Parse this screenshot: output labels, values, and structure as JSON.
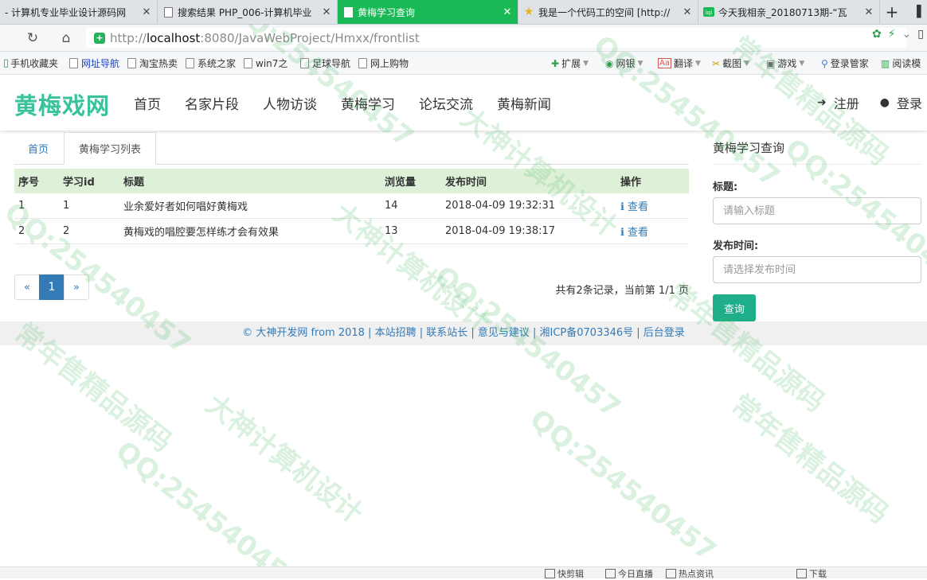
{
  "browser": {
    "tabs": [
      {
        "label": "- 计算机专业毕业设计源码网",
        "active": false,
        "icon": "page-icon"
      },
      {
        "label": "搜索结果 PHP_006-计算机毕业",
        "active": false,
        "icon": "page-icon"
      },
      {
        "label": "黄梅学习查询",
        "active": true,
        "icon": "page-icon"
      },
      {
        "label": "我是一个代码工的空间 [http://",
        "active": false,
        "icon": "star-icon"
      },
      {
        "label": "今天我相亲_20180713期-“瓦",
        "active": false,
        "icon": "video-icon"
      }
    ],
    "new_tab": "+",
    "address": {
      "scheme": "http://",
      "host": "localhost",
      "rest": ":8080/JavaWebProject/Hmxx/frontlist"
    },
    "bookmarks": [
      {
        "label": "手机收藏夹",
        "icon": "star-icon"
      },
      {
        "label": "网址导航",
        "icon": "page-icon",
        "highlight": true
      },
      {
        "label": "淘宝热卖",
        "icon": "page-icon"
      },
      {
        "label": "系统之家",
        "icon": "page-icon"
      },
      {
        "label": "win7之",
        "icon": "page-icon"
      },
      {
        "label": "足球导航",
        "icon": "page-icon"
      },
      {
        "label": "网上购物",
        "icon": "page-icon"
      }
    ],
    "toolbar_right": [
      {
        "label": "扩展",
        "icon": "puzzle-icon"
      },
      {
        "label": "网银",
        "icon": "bank-icon"
      },
      {
        "label": "翻译",
        "icon": "translate-icon"
      },
      {
        "label": "截图",
        "icon": "scissors-icon"
      },
      {
        "label": "游戏",
        "icon": "gamepad-icon"
      },
      {
        "label": "登录管家",
        "icon": "key-icon"
      },
      {
        "label": "阅读模",
        "icon": "book-icon"
      }
    ]
  },
  "site": {
    "brand": "黄梅戏网",
    "nav": [
      "首页",
      "名家片段",
      "人物访谈",
      "黄梅学习",
      "论坛交流",
      "黄梅新闻"
    ],
    "register": "注册",
    "login": "登录"
  },
  "content": {
    "tabs": {
      "home": "首页",
      "active": "黄梅学习列表"
    },
    "table": {
      "headers": [
        "序号",
        "学习id",
        "标题",
        "浏览量",
        "发布时间",
        "操作"
      ],
      "rows": [
        {
          "no": "1",
          "id": "1",
          "title": "业余爱好者如何唱好黄梅戏",
          "views": "14",
          "time": "2018-04-09 19:32:31",
          "action": "查看"
        },
        {
          "no": "2",
          "id": "2",
          "title": "黄梅戏的唱腔要怎样练才会有效果",
          "views": "13",
          "time": "2018-04-09 19:38:17",
          "action": "查看"
        }
      ]
    },
    "pager": {
      "prev": "«",
      "current": "1",
      "next": "»"
    },
    "record_info": "共有2条记录，当前第 1/1 页"
  },
  "sidebar": {
    "title": "黄梅学习查询",
    "title_label": "标题:",
    "title_placeholder": "请输入标题",
    "time_label": "发布时间:",
    "time_placeholder": "请选择发布时间",
    "query_button": "查询"
  },
  "footer": {
    "text": "© 大神开发网 from 2018 | 本站招聘 | 联系站长 | 意见与建议 | 湘ICP备0703346号 | 后台登录"
  },
  "watermark": {
    "texts": [
      "QQ:254540457",
      "大神计算机设计",
      "常年售精品源码"
    ]
  },
  "statusbar": {
    "items": [
      "快剪辑",
      "今日直播",
      "热点资讯",
      "下载"
    ]
  }
}
